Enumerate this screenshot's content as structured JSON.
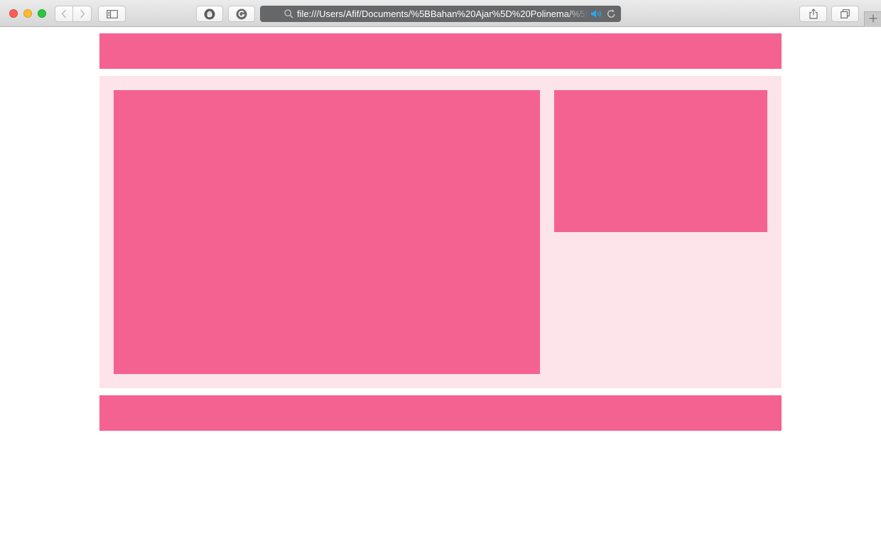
{
  "browser": {
    "url": "file:///Users/Afif/Documents/%5BBahan%20Ajar%5D%20Polinema/%5BM",
    "icons": {
      "back": "chevron-left-icon",
      "forward": "chevron-right-icon",
      "sidebar": "sidebar-icon",
      "extension_1": "hand-stop-icon",
      "extension_2": "grammarly-icon",
      "search": "search-icon",
      "audio": "speaker-icon",
      "reload": "reload-icon",
      "share": "share-icon",
      "tabs": "tab-overview-icon",
      "new_tab": "plus-icon"
    }
  },
  "page": {
    "colors": {
      "block": "#f46291",
      "container_bg": "#fde3ea",
      "page_bg": "#ffffff"
    }
  }
}
